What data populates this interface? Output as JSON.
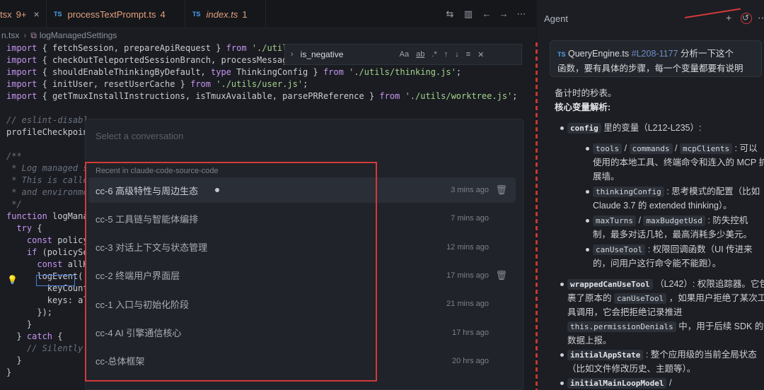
{
  "tabs": [
    {
      "prefix": "tsx",
      "badge": "9+",
      "close": "×"
    },
    {
      "icon": "TS",
      "name": "processTextPrompt.ts",
      "count": "4"
    },
    {
      "icon": "TS",
      "name": "index.ts",
      "count": "1"
    }
  ],
  "breadcrumb": {
    "file": "n.tsx",
    "symbol": "logManagedSettings"
  },
  "code_lines": [
    "import { fetchSession, prepareApiRequest } from './utils/",
    "import { checkOutTeleportedSessionBranch, processMessages",
    "import { shouldEnableThinkingByDefault, type ThinkingConfig } from './utils/thinking.js';",
    "import { initUser, resetUserCache } from './utils/user.js';",
    "import { getTmuxInstallInstructions, isTmuxAvailable, parsePRReference } from './utils/worktree.js';",
    "",
    "// eslint-disabl",
    "profileCheckpoin",
    "",
    "/**",
    " * Log managed s",
    " * This is calle",
    " * and environme",
    " */",
    "function logManag",
    "  try {",
    "    const policy",
    "    if (policySe",
    "      const allK",
    "      logEvent('",
    "        keyCount",
    "        keys: al",
    "      });",
    "    }",
    "  } catch {",
    "    // Silently",
    "  }",
    "}"
  ],
  "find": {
    "query": "is_negative",
    "chevron": "›",
    "opt_case": "Aa",
    "opt_word": "ab",
    "opt_regex": ".*"
  },
  "picker": {
    "placeholder": "Select a conversation",
    "section": "Recent in claude-code-source-code",
    "items": [
      {
        "title": "cc-6 高级特性与周边生态",
        "time": "3 mins ago"
      },
      {
        "title": "cc-5 工具链与智能体编排",
        "time": "7 mins ago"
      },
      {
        "title": "cc-3 对话上下文与状态管理",
        "time": "12 mins ago"
      },
      {
        "title": "cc-2 终端用户界面层",
        "time": "17 mins ago"
      },
      {
        "title": "cc-1 入口与初始化阶段",
        "time": "21 mins ago"
      },
      {
        "title": "cc-4 AI 引擎通信核心",
        "time": "17 hrs ago"
      },
      {
        "title": "cc-总体框架",
        "time": "20 hrs ago"
      }
    ]
  },
  "agent": {
    "title": "Agent",
    "prompt": {
      "badge": "TS",
      "file": "QueryEngine.ts",
      "range": "#L208-1177",
      "text1": "分析一下这个",
      "text2": "函数，要有具体的步骤，每一个变量都要有说明"
    },
    "body": {
      "line0": "备计时的秒表。",
      "heading": "核心变量解析:",
      "config_chip": "config",
      "config_text": "里的变量（L212-L235）:",
      "tools": "tools",
      "commands": "commands",
      "mcpClients": "mcpClients",
      "tools_text1": ": 可以",
      "tools_text2": "使用的本地工具、终端命令和连入的 MCP 扩",
      "tools_text3": "展墙。",
      "thinkingConfig": "thinkingConfig",
      "thinking_text1": ": 思考模式的配置（比如",
      "thinking_text2": "Claude 3.7 的 extended thinking）。",
      "maxTurns": "maxTurns",
      "maxBudgetUsd": "maxBudgetUsd",
      "turns_text1": ": 防失控机",
      "turns_text2": "制，最多对话几轮，最高消耗多少美元。",
      "canUseTool": "canUseTool",
      "canuse_text1": ": 权限回调函数（UI 传进来",
      "canuse_text2": "的，问用户这行命令能不能跑）。",
      "wrapped": "wrappedCanUseTool",
      "wrapped_text1": "（L242）: 权限追踪器。它包",
      "wrapped_text2": "裹了原本的",
      "wrapped_chip2": "canUseTool",
      "wrapped_text3": "，如果用户拒绝了某次工",
      "wrapped_text4": "具调用，它会把拒绝记录推进",
      "perm_chip": "this.permissionDenials",
      "wrapped_text5": "中，用于后续 SDK 的",
      "wrapped_text6": "数据上报。",
      "initialAppState": "initialAppState",
      "appstate_text1": ": 整个应用级的当前全局状态",
      "appstate_text2": "（比如文件修改历史、主题等）。",
      "initialMainLoopModel": "initialMainLoopModel",
      "loop_text": "/"
    }
  },
  "colors": {
    "accent_red": "#d23a3a",
    "ts_blue": "#4aa3f0",
    "keyword": "#c695f0",
    "string": "#a5d38a"
  }
}
